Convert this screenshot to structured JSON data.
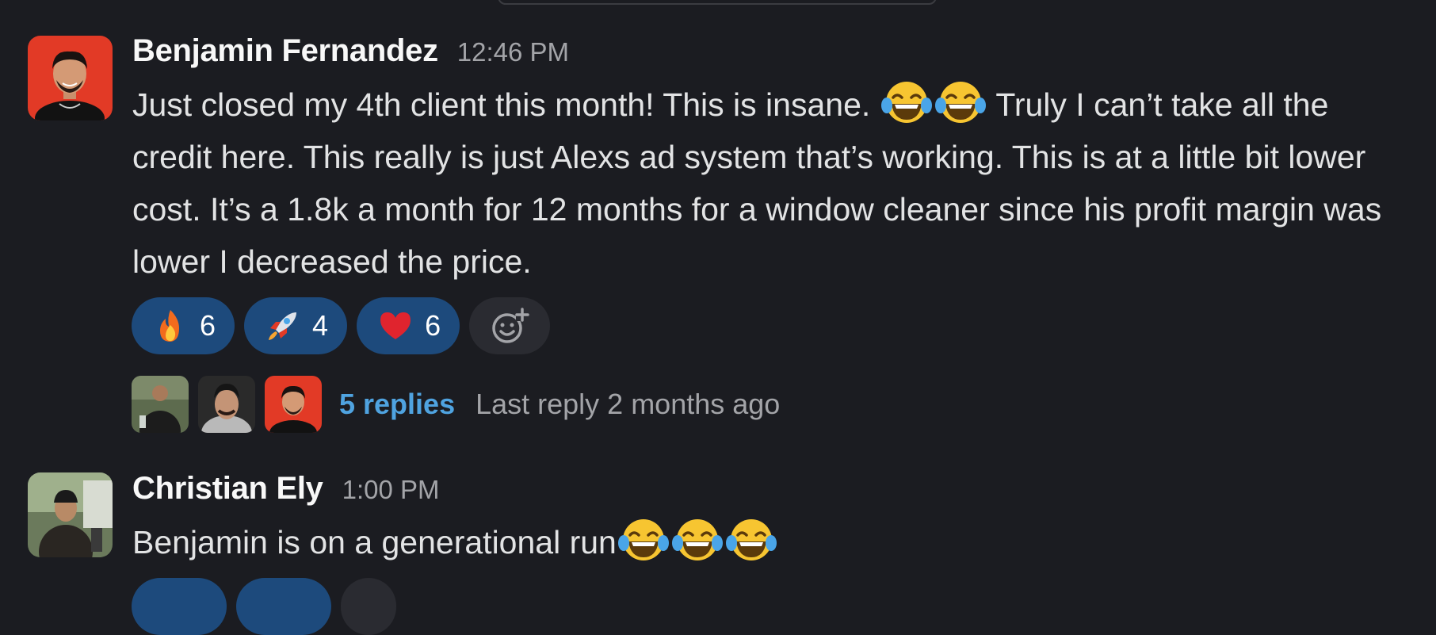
{
  "messages": [
    {
      "author": "Benjamin Fernandez",
      "time": "12:46 PM",
      "text_part1": "Just closed my 4th client this month! This is insane. ",
      "text_part2": " Truly I can’t take all the credit here. This really is just Alexs ad system that’s working. This is at a little bit lower cost. It’s a 1.8k a month for 12 months for a window cleaner since his profit margin was lower I decreased the price.",
      "inline_emoji": [
        "joy-emoji",
        "joy-emoji"
      ],
      "reactions": [
        {
          "icon": "fire-emoji",
          "count": "6"
        },
        {
          "icon": "rocket-emoji",
          "count": "4"
        },
        {
          "icon": "red-heart-emoji",
          "count": "6"
        }
      ],
      "add_reaction_icon": "add-reaction-icon",
      "thread": {
        "replies": "5 replies",
        "last_reply": "Last reply 2 months ago"
      }
    },
    {
      "author": "Christian Ely",
      "time": "1:00 PM",
      "text": "Benjamin is on a generational run",
      "inline_emoji": [
        "joy-emoji",
        "joy-emoji",
        "joy-emoji"
      ]
    }
  ],
  "colors": {
    "background": "#1b1c21",
    "reaction_active": "#1d4a7c",
    "link": "#4fa3e0",
    "muted": "#a3a4a8"
  }
}
